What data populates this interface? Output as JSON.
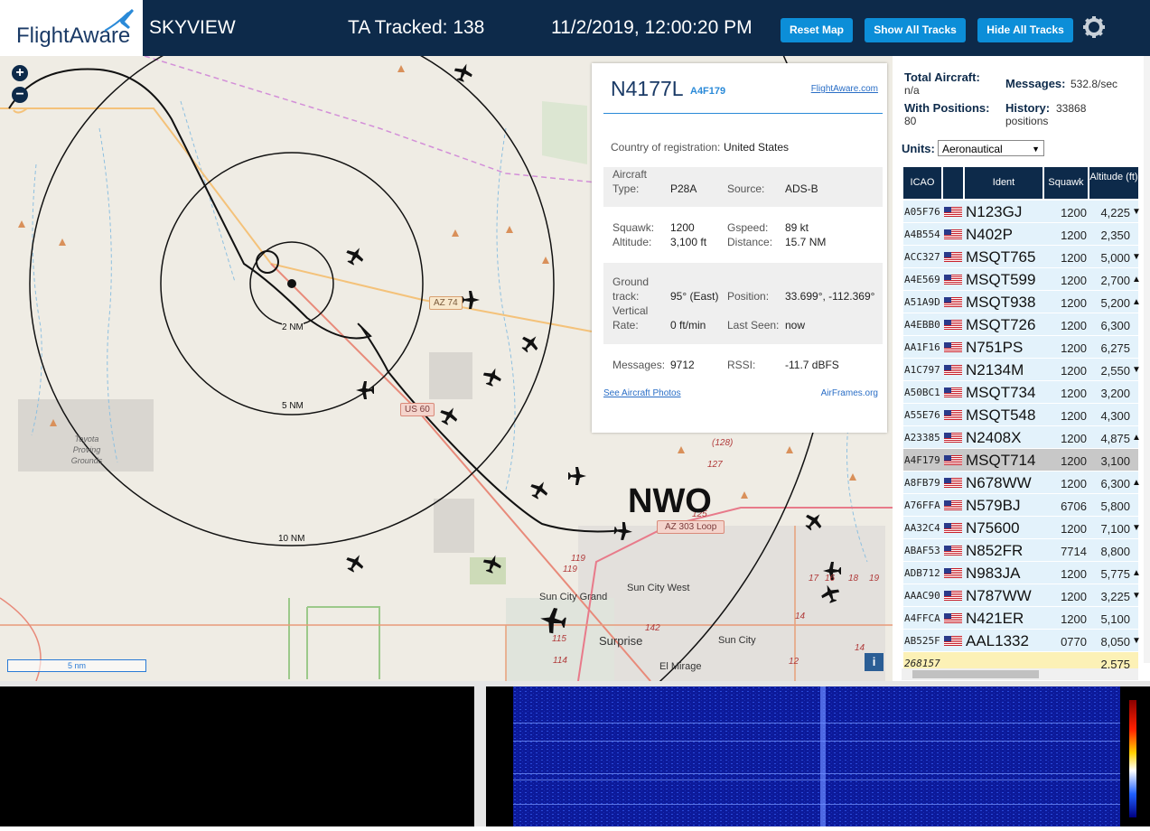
{
  "header": {
    "logo": "FlightAware",
    "app_name": "SKYVIEW",
    "tracked": "TA Tracked: 138",
    "datetime": "11/2/2019, 12:00:20 PM",
    "buttons": {
      "reset": "Reset Map",
      "show": "Show All Tracks",
      "hide": "Hide All Tracks"
    },
    "settings_icon": "gear-icon",
    "colors": {
      "bar": "#0d2a4a",
      "button": "#0c8ed8"
    }
  },
  "map": {
    "zoom_in": "+",
    "zoom_out": "−",
    "scale_label": "5 nm",
    "info_label": "i",
    "site_label": "NWO",
    "range_rings": [
      "2 NM",
      "5 NM",
      "10 NM"
    ],
    "road_labels": [
      "AZ 74",
      "US 60",
      "AZ 303 Loop"
    ],
    "place_labels": [
      "Toyota Proving Grounds",
      "Sun City Grand",
      "Sun City West",
      "Surprise",
      "Sun City",
      "El Mirage"
    ],
    "route_numbers": [
      "(128)",
      "127",
      "125",
      "119",
      "119",
      "115",
      "114",
      "142",
      "14",
      "12",
      "17",
      "16",
      "18",
      "19",
      "14"
    ]
  },
  "aircraft_panel": {
    "registration": "N4177L",
    "hex": "A4F179",
    "link_fa": "FlightAware.com",
    "country": {
      "label": "Country of registration:",
      "value": "United States"
    },
    "type": {
      "label1": "Aircraft",
      "label2": "Type:",
      "value": "P28A"
    },
    "source": {
      "label": "Source:",
      "value": "ADS-B"
    },
    "squawk": {
      "label": "Squawk:",
      "value": "1200"
    },
    "gspeed": {
      "label": "Gspeed:",
      "value": "89 kt"
    },
    "altitude": {
      "label": "Altitude:",
      "value": "3,100 ft"
    },
    "distance": {
      "label": "Distance:",
      "value": "15.7 NM"
    },
    "ground_track": {
      "label1": "Ground",
      "label2": "track:",
      "value": "95° (East)"
    },
    "position": {
      "label": "Position:",
      "value": "33.699°, -112.369°"
    },
    "vertical_rate": {
      "label1": "Vertical",
      "label2": "Rate:",
      "value": "0 ft/min"
    },
    "last_seen": {
      "label": "Last Seen:",
      "value": "now"
    },
    "messages": {
      "label": "Messages:",
      "value": "9712"
    },
    "rssi": {
      "label": "RSSI:",
      "value": "-11.7 dBFS"
    },
    "link_photos": "See Aircraft Photos",
    "link_airframes": "AirFrames.org"
  },
  "sidebar": {
    "total_aircraft": {
      "label": "Total Aircraft:",
      "value": "n/a"
    },
    "messages": {
      "label": "Messages:",
      "value": "532.8/sec"
    },
    "with_positions": {
      "label": "With Positions:",
      "value": "80"
    },
    "history": {
      "label": "History:",
      "value": "33868",
      "unit": "positions"
    },
    "units": {
      "label": "Units:",
      "value": "Aeronautical"
    },
    "columns": {
      "icao": "ICAO",
      "ident": "Ident",
      "squawk": "Squawk",
      "altitude": "Altitude (ft)"
    },
    "rows": [
      {
        "icao": "A05F76",
        "ident": "N123GJ",
        "squawk": "1200",
        "alt": "4,225",
        "arrow": "▼"
      },
      {
        "icao": "A4B554",
        "ident": "N402P",
        "squawk": "1200",
        "alt": "2,350",
        "arrow": ""
      },
      {
        "icao": "ACC327",
        "ident": "MSQT765",
        "squawk": "1200",
        "alt": "5,000",
        "arrow": "▼"
      },
      {
        "icao": "A4E569",
        "ident": "MSQT599",
        "squawk": "1200",
        "alt": "2,700",
        "arrow": "▲"
      },
      {
        "icao": "A51A9D",
        "ident": "MSQT938",
        "squawk": "1200",
        "alt": "5,200",
        "arrow": "▲"
      },
      {
        "icao": "A4EBB0",
        "ident": "MSQT726",
        "squawk": "1200",
        "alt": "6,300",
        "arrow": ""
      },
      {
        "icao": "AA1F16",
        "ident": "N751PS",
        "squawk": "1200",
        "alt": "6,275",
        "arrow": ""
      },
      {
        "icao": "A1C797",
        "ident": "N2134M",
        "squawk": "1200",
        "alt": "2,550",
        "arrow": "▼"
      },
      {
        "icao": "A50BC1",
        "ident": "MSQT734",
        "squawk": "1200",
        "alt": "3,200",
        "arrow": ""
      },
      {
        "icao": "A55E76",
        "ident": "MSQT548",
        "squawk": "1200",
        "alt": "4,300",
        "arrow": ""
      },
      {
        "icao": "A23385",
        "ident": "N2408X",
        "squawk": "1200",
        "alt": "4,875",
        "arrow": "▲"
      },
      {
        "icao": "A4F179",
        "ident": "MSQT714",
        "squawk": "1200",
        "alt": "3,100",
        "arrow": ""
      },
      {
        "icao": "A8FB79",
        "ident": "N678WW",
        "squawk": "1200",
        "alt": "6,300",
        "arrow": "▲"
      },
      {
        "icao": "A76FFA",
        "ident": "N579BJ",
        "squawk": "6706",
        "alt": "5,800",
        "arrow": ""
      },
      {
        "icao": "AA32C4",
        "ident": "N75600",
        "squawk": "1200",
        "alt": "7,100",
        "arrow": "▼"
      },
      {
        "icao": "ABAF53",
        "ident": "N852FR",
        "squawk": "7714",
        "alt": "8,800",
        "arrow": ""
      },
      {
        "icao": "ADB712",
        "ident": "N983JA",
        "squawk": "1200",
        "alt": "5,775",
        "arrow": "▲"
      },
      {
        "icao": "AAAC90",
        "ident": "N787WW",
        "squawk": "1200",
        "alt": "3,225",
        "arrow": "▼"
      },
      {
        "icao": "A4FFCA",
        "ident": "N421ER",
        "squawk": "1200",
        "alt": "5,100",
        "arrow": ""
      },
      {
        "icao": "AB525F",
        "ident": "AAL1332",
        "squawk": "0770",
        "alt": "8,050",
        "arrow": "▼"
      },
      {
        "icao": "268157",
        "ident": "",
        "squawk": "",
        "alt": "2,575",
        "arrow": ""
      }
    ]
  }
}
